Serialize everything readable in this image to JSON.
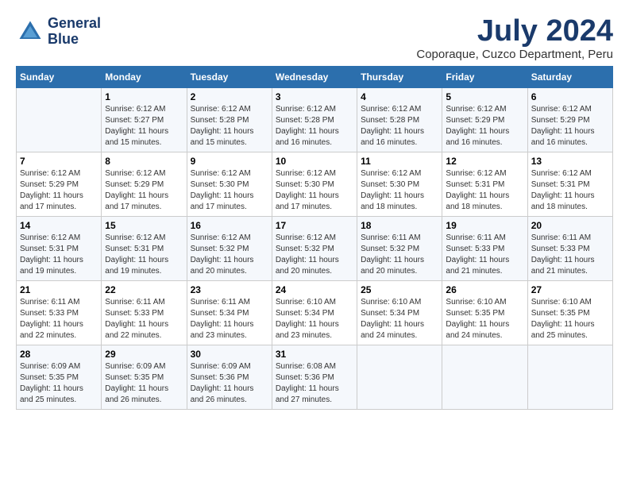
{
  "header": {
    "logo_line1": "General",
    "logo_line2": "Blue",
    "month": "July 2024",
    "location": "Coporaque, Cuzco Department, Peru"
  },
  "weekdays": [
    "Sunday",
    "Monday",
    "Tuesday",
    "Wednesday",
    "Thursday",
    "Friday",
    "Saturday"
  ],
  "weeks": [
    [
      {
        "day": "",
        "sunrise": "",
        "sunset": "",
        "daylight": ""
      },
      {
        "day": "1",
        "sunrise": "Sunrise: 6:12 AM",
        "sunset": "Sunset: 5:27 PM",
        "daylight": "Daylight: 11 hours and 15 minutes."
      },
      {
        "day": "2",
        "sunrise": "Sunrise: 6:12 AM",
        "sunset": "Sunset: 5:28 PM",
        "daylight": "Daylight: 11 hours and 15 minutes."
      },
      {
        "day": "3",
        "sunrise": "Sunrise: 6:12 AM",
        "sunset": "Sunset: 5:28 PM",
        "daylight": "Daylight: 11 hours and 16 minutes."
      },
      {
        "day": "4",
        "sunrise": "Sunrise: 6:12 AM",
        "sunset": "Sunset: 5:28 PM",
        "daylight": "Daylight: 11 hours and 16 minutes."
      },
      {
        "day": "5",
        "sunrise": "Sunrise: 6:12 AM",
        "sunset": "Sunset: 5:29 PM",
        "daylight": "Daylight: 11 hours and 16 minutes."
      },
      {
        "day": "6",
        "sunrise": "Sunrise: 6:12 AM",
        "sunset": "Sunset: 5:29 PM",
        "daylight": "Daylight: 11 hours and 16 minutes."
      }
    ],
    [
      {
        "day": "7",
        "sunrise": "Sunrise: 6:12 AM",
        "sunset": "Sunset: 5:29 PM",
        "daylight": "Daylight: 11 hours and 17 minutes."
      },
      {
        "day": "8",
        "sunrise": "Sunrise: 6:12 AM",
        "sunset": "Sunset: 5:29 PM",
        "daylight": "Daylight: 11 hours and 17 minutes."
      },
      {
        "day": "9",
        "sunrise": "Sunrise: 6:12 AM",
        "sunset": "Sunset: 5:30 PM",
        "daylight": "Daylight: 11 hours and 17 minutes."
      },
      {
        "day": "10",
        "sunrise": "Sunrise: 6:12 AM",
        "sunset": "Sunset: 5:30 PM",
        "daylight": "Daylight: 11 hours and 17 minutes."
      },
      {
        "day": "11",
        "sunrise": "Sunrise: 6:12 AM",
        "sunset": "Sunset: 5:30 PM",
        "daylight": "Daylight: 11 hours and 18 minutes."
      },
      {
        "day": "12",
        "sunrise": "Sunrise: 6:12 AM",
        "sunset": "Sunset: 5:31 PM",
        "daylight": "Daylight: 11 hours and 18 minutes."
      },
      {
        "day": "13",
        "sunrise": "Sunrise: 6:12 AM",
        "sunset": "Sunset: 5:31 PM",
        "daylight": "Daylight: 11 hours and 18 minutes."
      }
    ],
    [
      {
        "day": "14",
        "sunrise": "Sunrise: 6:12 AM",
        "sunset": "Sunset: 5:31 PM",
        "daylight": "Daylight: 11 hours and 19 minutes."
      },
      {
        "day": "15",
        "sunrise": "Sunrise: 6:12 AM",
        "sunset": "Sunset: 5:31 PM",
        "daylight": "Daylight: 11 hours and 19 minutes."
      },
      {
        "day": "16",
        "sunrise": "Sunrise: 6:12 AM",
        "sunset": "Sunset: 5:32 PM",
        "daylight": "Daylight: 11 hours and 20 minutes."
      },
      {
        "day": "17",
        "sunrise": "Sunrise: 6:12 AM",
        "sunset": "Sunset: 5:32 PM",
        "daylight": "Daylight: 11 hours and 20 minutes."
      },
      {
        "day": "18",
        "sunrise": "Sunrise: 6:11 AM",
        "sunset": "Sunset: 5:32 PM",
        "daylight": "Daylight: 11 hours and 20 minutes."
      },
      {
        "day": "19",
        "sunrise": "Sunrise: 6:11 AM",
        "sunset": "Sunset: 5:33 PM",
        "daylight": "Daylight: 11 hours and 21 minutes."
      },
      {
        "day": "20",
        "sunrise": "Sunrise: 6:11 AM",
        "sunset": "Sunset: 5:33 PM",
        "daylight": "Daylight: 11 hours and 21 minutes."
      }
    ],
    [
      {
        "day": "21",
        "sunrise": "Sunrise: 6:11 AM",
        "sunset": "Sunset: 5:33 PM",
        "daylight": "Daylight: 11 hours and 22 minutes."
      },
      {
        "day": "22",
        "sunrise": "Sunrise: 6:11 AM",
        "sunset": "Sunset: 5:33 PM",
        "daylight": "Daylight: 11 hours and 22 minutes."
      },
      {
        "day": "23",
        "sunrise": "Sunrise: 6:11 AM",
        "sunset": "Sunset: 5:34 PM",
        "daylight": "Daylight: 11 hours and 23 minutes."
      },
      {
        "day": "24",
        "sunrise": "Sunrise: 6:10 AM",
        "sunset": "Sunset: 5:34 PM",
        "daylight": "Daylight: 11 hours and 23 minutes."
      },
      {
        "day": "25",
        "sunrise": "Sunrise: 6:10 AM",
        "sunset": "Sunset: 5:34 PM",
        "daylight": "Daylight: 11 hours and 24 minutes."
      },
      {
        "day": "26",
        "sunrise": "Sunrise: 6:10 AM",
        "sunset": "Sunset: 5:35 PM",
        "daylight": "Daylight: 11 hours and 24 minutes."
      },
      {
        "day": "27",
        "sunrise": "Sunrise: 6:10 AM",
        "sunset": "Sunset: 5:35 PM",
        "daylight": "Daylight: 11 hours and 25 minutes."
      }
    ],
    [
      {
        "day": "28",
        "sunrise": "Sunrise: 6:09 AM",
        "sunset": "Sunset: 5:35 PM",
        "daylight": "Daylight: 11 hours and 25 minutes."
      },
      {
        "day": "29",
        "sunrise": "Sunrise: 6:09 AM",
        "sunset": "Sunset: 5:35 PM",
        "daylight": "Daylight: 11 hours and 26 minutes."
      },
      {
        "day": "30",
        "sunrise": "Sunrise: 6:09 AM",
        "sunset": "Sunset: 5:36 PM",
        "daylight": "Daylight: 11 hours and 26 minutes."
      },
      {
        "day": "31",
        "sunrise": "Sunrise: 6:08 AM",
        "sunset": "Sunset: 5:36 PM",
        "daylight": "Daylight: 11 hours and 27 minutes."
      },
      {
        "day": "",
        "sunrise": "",
        "sunset": "",
        "daylight": ""
      },
      {
        "day": "",
        "sunrise": "",
        "sunset": "",
        "daylight": ""
      },
      {
        "day": "",
        "sunrise": "",
        "sunset": "",
        "daylight": ""
      }
    ]
  ]
}
